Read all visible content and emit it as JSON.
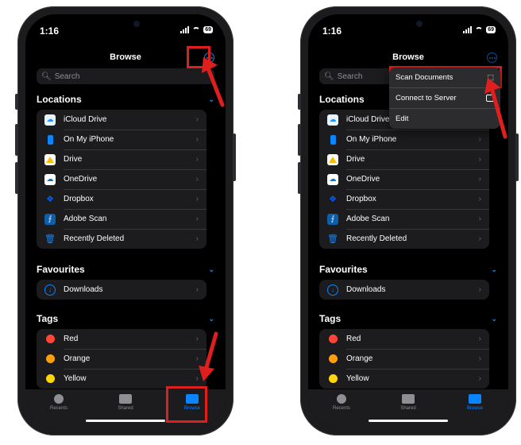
{
  "status": {
    "time": "1:16",
    "battery": "69"
  },
  "nav": {
    "title": "Browse"
  },
  "search": {
    "placeholder": "Search"
  },
  "sections": {
    "locations": "Locations",
    "favourites": "Favourites",
    "tags": "Tags"
  },
  "locations": [
    {
      "label": "iCloud Drive",
      "icon": "icloud-icon",
      "color": "#1e90ff"
    },
    {
      "label": "On My iPhone",
      "icon": "iphone-icon",
      "color": "#0a84ff"
    },
    {
      "label": "Drive",
      "icon": "google-drive-icon",
      "color": "#34a853"
    },
    {
      "label": "OneDrive",
      "icon": "onedrive-icon",
      "color": "#0078d4"
    },
    {
      "label": "Dropbox",
      "icon": "dropbox-icon",
      "color": "#0061ff"
    },
    {
      "label": "Adobe Scan",
      "icon": "adobe-scan-icon",
      "color": "#0e5fa8"
    },
    {
      "label": "Recently Deleted",
      "icon": "trash-icon",
      "color": "#0a84ff"
    }
  ],
  "favourites": [
    {
      "label": "Downloads",
      "icon": "download-icon",
      "color": "#0a84ff"
    }
  ],
  "tags": [
    {
      "label": "Red",
      "color": "#ff453a"
    },
    {
      "label": "Orange",
      "color": "#ff9f0a"
    },
    {
      "label": "Yellow",
      "color": "#ffd60a"
    }
  ],
  "tabs": [
    {
      "label": "Recents"
    },
    {
      "label": "Shared"
    },
    {
      "label": "Browse"
    }
  ],
  "menu": [
    {
      "label": "Scan Documents",
      "icon": "scan-icon"
    },
    {
      "label": "Connect to Server",
      "icon": "monitor-icon"
    },
    {
      "label": "Edit"
    }
  ],
  "colors": {
    "accent": "#0a84ff",
    "highlight": "#e01e1e",
    "background": "#000000"
  }
}
